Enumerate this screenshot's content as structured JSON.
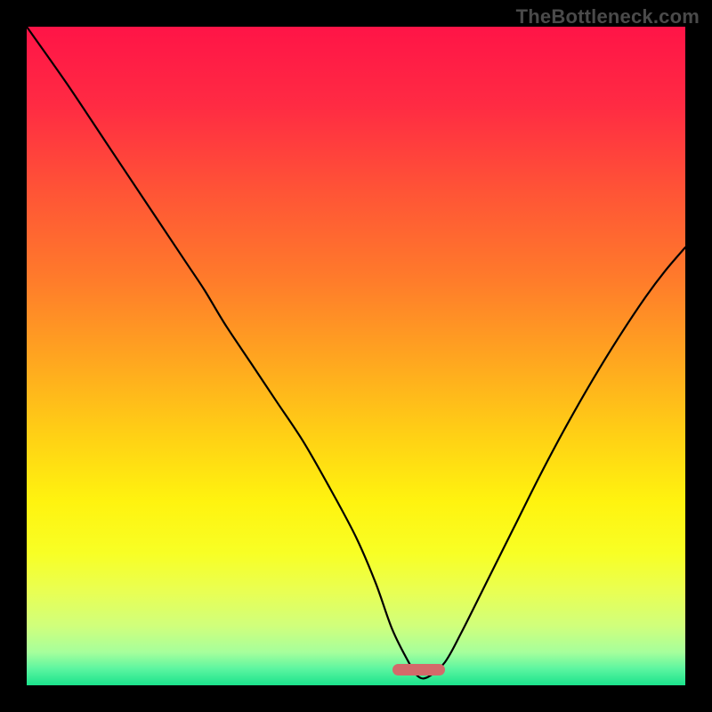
{
  "watermark": "TheBottleneck.com",
  "marker": {
    "x_frac_start": 0.555,
    "x_frac_end": 0.635,
    "y_frac": 0.975,
    "color": "#d36a6a"
  },
  "gradient_stops": [
    {
      "offset": 0.0,
      "color": "#ff1447"
    },
    {
      "offset": 0.12,
      "color": "#ff2b43"
    },
    {
      "offset": 0.25,
      "color": "#ff5436"
    },
    {
      "offset": 0.38,
      "color": "#ff7a2b"
    },
    {
      "offset": 0.5,
      "color": "#ffa420"
    },
    {
      "offset": 0.62,
      "color": "#ffd015"
    },
    {
      "offset": 0.72,
      "color": "#fff30f"
    },
    {
      "offset": 0.8,
      "color": "#f8ff25"
    },
    {
      "offset": 0.86,
      "color": "#e8ff55"
    },
    {
      "offset": 0.91,
      "color": "#d0ff7c"
    },
    {
      "offset": 0.95,
      "color": "#a6ff9c"
    },
    {
      "offset": 0.975,
      "color": "#5cf5a0"
    },
    {
      "offset": 1.0,
      "color": "#1be38c"
    }
  ],
  "chart_data": {
    "type": "line",
    "title": "",
    "xlabel": "",
    "ylabel": "",
    "xlim": [
      0,
      100
    ],
    "ylim": [
      0,
      100
    ],
    "x": [
      0,
      6,
      12,
      18,
      24,
      27,
      30,
      34,
      38,
      42,
      46,
      50,
      53,
      55.5,
      58,
      59.5,
      61,
      63.5,
      66,
      70,
      74,
      78,
      82,
      86,
      90,
      94,
      97,
      100
    ],
    "values": [
      100,
      91.5,
      82.5,
      73.5,
      64.5,
      60,
      55,
      49,
      43,
      37,
      30,
      22.5,
      15.5,
      8.5,
      3.5,
      1.3,
      1.3,
      3.5,
      8,
      16,
      24,
      32,
      39.5,
      46.5,
      53,
      59,
      63,
      66.5
    ],
    "annotations": [
      {
        "text": "TheBottleneck.com",
        "position": "top-right"
      }
    ]
  }
}
